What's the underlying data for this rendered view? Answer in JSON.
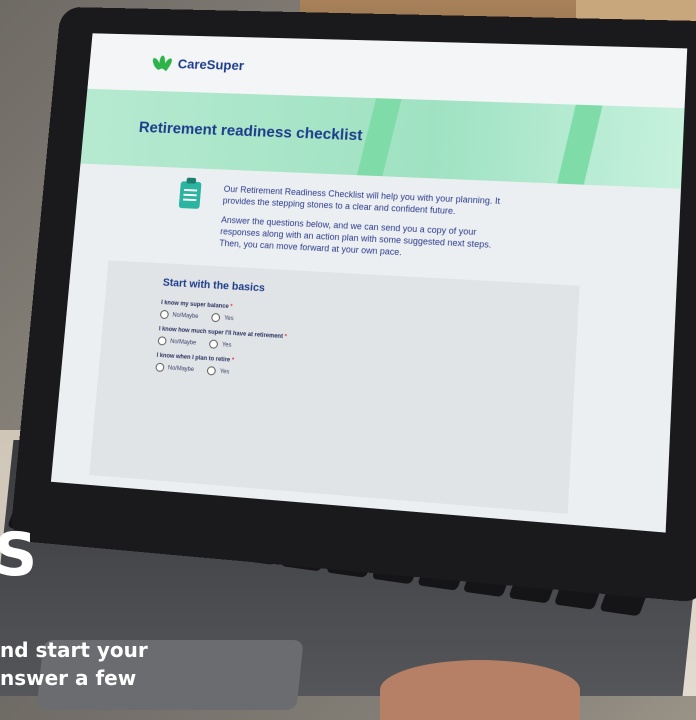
{
  "site": {
    "logo_text": "CareSuper",
    "page_title": "Retirement readiness checklist",
    "intro_p1": "Our Retirement Readiness Checklist will help you with your planning. It provides the stepping stones to a clear and confident future.",
    "intro_p2": "Answer the questions below, and we can send you a copy of your responses along with an action plan with some suggested next steps. Then, you can move forward at your own pace."
  },
  "form": {
    "section_title": "Start with the basics",
    "questions": [
      {
        "label": "I know my super balance",
        "required": "*",
        "options": [
          "No/Maybe",
          "Yes"
        ]
      },
      {
        "label": "I know how much super I'll have at retirement",
        "required": "*",
        "options": [
          "No/Maybe",
          "Yes"
        ]
      },
      {
        "label": "I know when I plan to retire",
        "required": "*",
        "options": [
          "No/Maybe",
          "Yes"
        ]
      }
    ]
  },
  "overlay": {
    "big_letter": "S",
    "line1": "nd start your",
    "line2": "nswer a few"
  },
  "colors": {
    "brand_blue": "#1d3c8c",
    "brand_green": "#2db34a",
    "banner_green": "#9fe2c2",
    "required_red": "#e0312f"
  }
}
